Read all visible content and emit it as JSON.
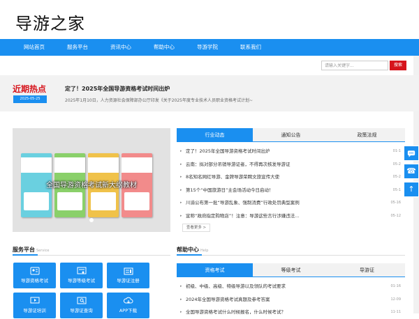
{
  "site": {
    "logo": "导游之家"
  },
  "nav": [
    "网站首页",
    "服务平台",
    "资讯中心",
    "帮助中心",
    "导游学院",
    "联系我们"
  ],
  "search": {
    "placeholder": "请输入关键字...",
    "button": "搜索"
  },
  "hot": {
    "title": "近期热点",
    "date": "2025-05-25",
    "headline": "定了！2025年全国导游资格考试时间出炉",
    "desc": "2025年1月10日，人力资源社会保障部办公厅印发《关于2025年度专业技术人员职业资格考试计划~"
  },
  "banner": {
    "caption": "全国导游资格考试新大纲教材"
  },
  "news_tabs": [
    "行业动态",
    "通知公告",
    "政策法规"
  ],
  "news": [
    {
      "title": "定了！2025年全国导游资格考试时间出炉",
      "date": "01-1"
    },
    {
      "title": "云南：拟对部分吊销导游证者，不得再次核发导游证",
      "date": "05-2"
    },
    {
      "title": "8名知名网红导游、金牌导游荣聘文旅宣传大使",
      "date": "05-2"
    },
    {
      "title": "第15个“中国旅游日”主会场活动今日启动！",
      "date": "05-1"
    },
    {
      "title": "川渝公布第一批“导游乱象、强制消费”行政处罚典型案例",
      "date": "05-16"
    },
    {
      "title": "宣称“政府指定购物店”！注意：导游这些言行涉嫌违法...",
      "date": "05-12"
    }
  ],
  "more": "查看更多 >",
  "service": {
    "title": "服务平台",
    "subtitle": "Service",
    "items": [
      "导游资格考试",
      "导游等级考试",
      "导游证注册",
      "导游证培训",
      "导游证查询",
      "APP下载"
    ],
    "icons": [
      "id-card-icon",
      "certificate-icon",
      "register-icon",
      "training-icon",
      "query-icon",
      "cloud-download-icon"
    ]
  },
  "help": {
    "title": "帮助中心",
    "subtitle": "Help",
    "tabs": [
      "资格考试",
      "等级考试",
      "导游证"
    ],
    "items": [
      {
        "title": "初级、中级、高级、特级导游以及领队的考试要求",
        "date": "01-16"
      },
      {
        "title": "2024年全国导游资格考试真题及参考答案",
        "date": "12-09"
      },
      {
        "title": "全国导游资格考试什么时候报名，什么时候考试？",
        "date": "11-11"
      }
    ]
  },
  "floating": {
    "icons": [
      "chat-icon",
      "phone-icon",
      "back-to-top-icon"
    ]
  },
  "colors": {
    "primary": "#1a8ff0",
    "accent": "#d6141c"
  }
}
